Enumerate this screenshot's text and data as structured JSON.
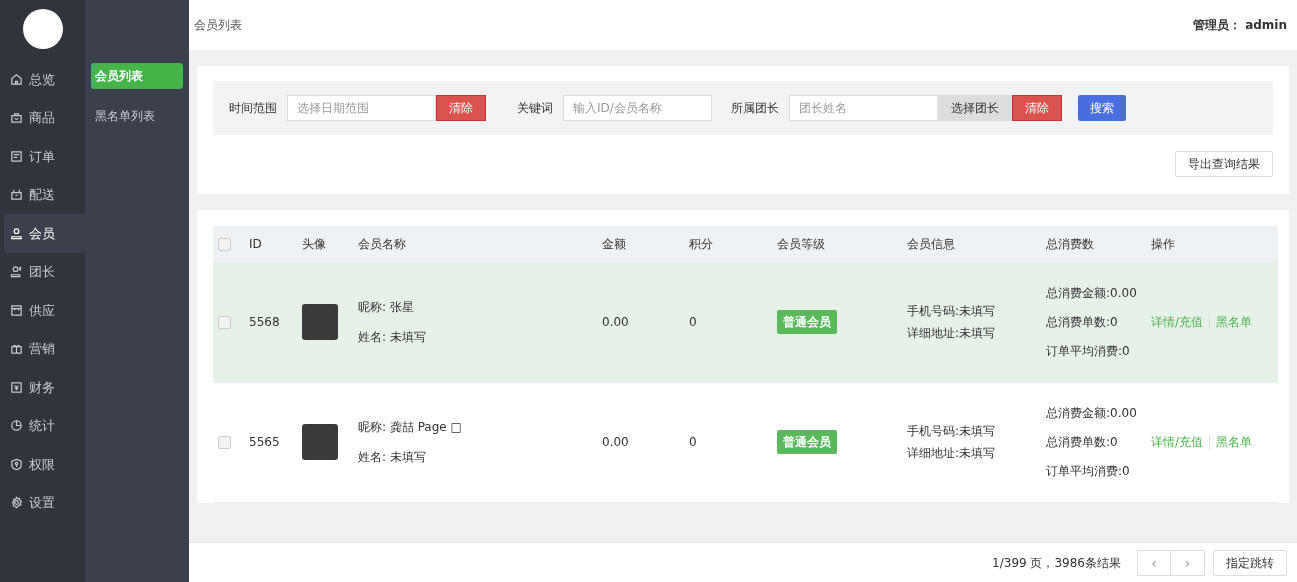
{
  "nav": [
    {
      "label": "总览",
      "selected": false
    },
    {
      "label": "商品",
      "selected": false
    },
    {
      "label": "订单",
      "selected": false
    },
    {
      "label": "配送",
      "selected": false
    },
    {
      "label": "会员",
      "selected": true
    },
    {
      "label": "团长",
      "selected": false
    },
    {
      "label": "供应",
      "selected": false
    },
    {
      "label": "营销",
      "selected": false
    },
    {
      "label": "财务",
      "selected": false
    },
    {
      "label": "统计",
      "selected": false
    },
    {
      "label": "权限",
      "selected": false
    },
    {
      "label": "设置",
      "selected": false
    }
  ],
  "subnav": [
    {
      "label": "会员列表",
      "selected": true
    },
    {
      "label": "黑名单列表",
      "selected": false
    }
  ],
  "header": {
    "breadcrumb": "会员列表",
    "admin_label": "管理员：",
    "admin_name": "admin"
  },
  "filters": {
    "time_label": "时间范围",
    "time_placeholder": "选择日期范围",
    "time_clear": "清除",
    "keyword_label": "关键词",
    "keyword_placeholder": "输入ID/会员名称",
    "leader_label": "所属团长",
    "leader_placeholder": "团长姓名",
    "leader_select": "选择团长",
    "leader_clear": "清除",
    "search": "搜索",
    "export": "导出查询结果"
  },
  "table": {
    "columns": [
      "ID",
      "头像",
      "会员名称",
      "金额",
      "积分",
      "会员等级",
      "会员信息",
      "总消费数",
      "操作"
    ],
    "header_checked": false,
    "rows": [
      {
        "checked": false,
        "highlighted": true,
        "id": "5568",
        "nickname": "昵称: 张星",
        "realname": "姓名: 未填写",
        "amount": "0.00",
        "points": "0",
        "level": "普通会员",
        "phone": "手机号码:未填写",
        "address": "详细地址:未填写",
        "spend": [
          "总消费金额:0.00",
          "总消费单数:0",
          "订单平均消费:0"
        ],
        "actions": [
          "详情/充值",
          "黑名单"
        ]
      },
      {
        "checked": false,
        "highlighted": false,
        "id": "5565",
        "nickname": "昵称: 龚喆 Page □",
        "realname": "姓名: 未填写",
        "amount": "0.00",
        "points": "0",
        "level": "普通会员",
        "phone": "手机号码:未填写",
        "address": "详细地址:未填写",
        "spend": [
          "总消费金额:0.00",
          "总消费单数:0",
          "订单平均消费:0"
        ],
        "actions": [
          "详情/充值",
          "黑名单"
        ]
      }
    ]
  },
  "pagination": {
    "summary": "1/399 页，3986条结果",
    "prev": "‹",
    "next": "›",
    "jump": "指定跳转"
  }
}
